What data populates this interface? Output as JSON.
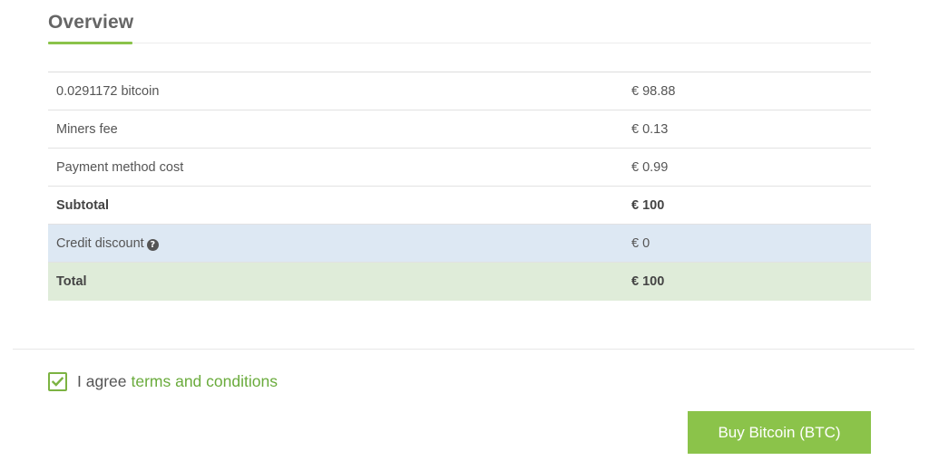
{
  "overview": {
    "title": "Overview"
  },
  "summary": {
    "rows": [
      {
        "label": "0.0291172 bitcoin",
        "value": "€ 98.88"
      },
      {
        "label": "Miners fee",
        "value": "€ 0.13"
      },
      {
        "label": "Payment method cost",
        "value": "€ 0.99"
      },
      {
        "label": "Subtotal",
        "value": "€ 100"
      },
      {
        "label": "Credit discount",
        "value": "€ 0",
        "help_icon": "question-circle-icon"
      },
      {
        "label": "Total",
        "value": "€ 100"
      }
    ]
  },
  "agreement": {
    "checked": true,
    "text": "I agree",
    "link_text": "terms and conditions"
  },
  "actions": {
    "buy_label": "Buy Bitcoin (BTC)"
  },
  "colors": {
    "accent_green": "#8bc34a",
    "link_green": "#6aab3c",
    "info_row_bg": "#dde8f3",
    "total_row_bg": "#dfecd9"
  }
}
